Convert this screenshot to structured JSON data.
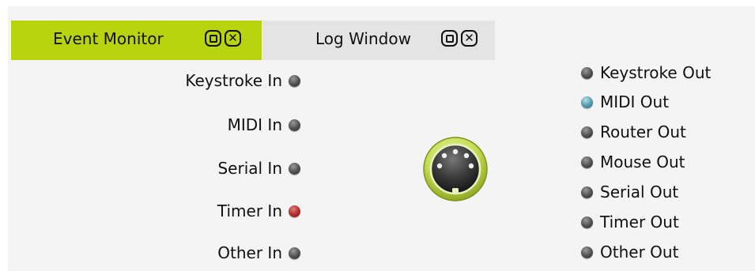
{
  "tabs": [
    {
      "label": "Event Monitor",
      "active": true
    },
    {
      "label": "Log Window",
      "active": false
    }
  ],
  "colors": {
    "active_tab": "#b8d40e",
    "inactive_tab": "#e4e4e4",
    "inactive_indicator": "#4e4e4e",
    "timer_in_indicator": "#b02a2a",
    "midi_out_indicator": "#4f99ad",
    "hub_ring": "#b8d40e"
  },
  "inputs": [
    {
      "label": "Keystroke In",
      "state": "idle"
    },
    {
      "label": "MIDI In",
      "state": "idle"
    },
    {
      "label": "Serial In",
      "state": "idle"
    },
    {
      "label": "Timer In",
      "state": "active-red"
    },
    {
      "label": "Other In",
      "state": "idle"
    }
  ],
  "outputs": [
    {
      "label": "Keystroke Out",
      "state": "idle"
    },
    {
      "label": "MIDI Out",
      "state": "active-blue"
    },
    {
      "label": "Router Out",
      "state": "idle"
    },
    {
      "label": "Mouse Out",
      "state": "idle"
    },
    {
      "label": "Serial Out",
      "state": "idle"
    },
    {
      "label": "Timer Out",
      "state": "idle"
    },
    {
      "label": "Other Out",
      "state": "idle"
    }
  ],
  "icons": {
    "maximize": "maximize-icon",
    "close": "close-icon",
    "hub": "midi-din-connector-icon"
  }
}
